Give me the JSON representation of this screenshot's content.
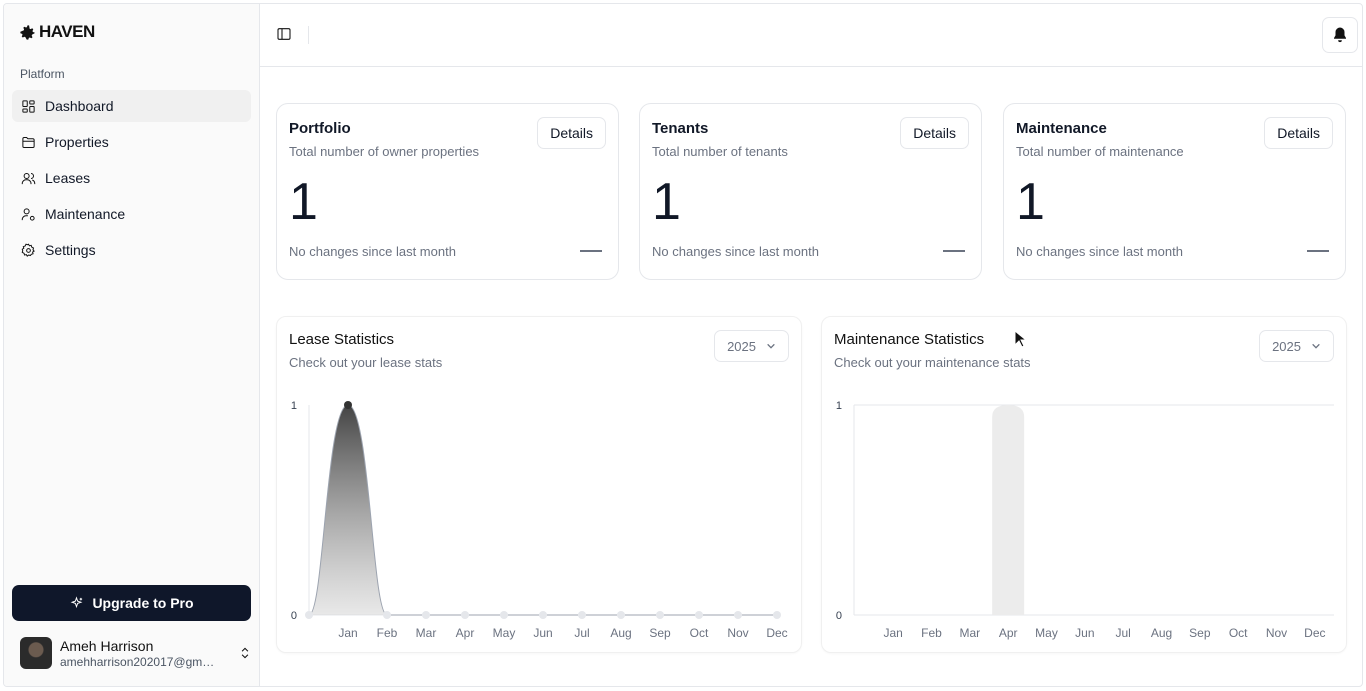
{
  "brand": {
    "name": "HAVEN"
  },
  "sidebar": {
    "section_label": "Platform",
    "items": [
      {
        "label": "Dashboard",
        "icon": "dashboard-icon",
        "active": true
      },
      {
        "label": "Properties",
        "icon": "folder-icon",
        "active": false
      },
      {
        "label": "Leases",
        "icon": "users-icon",
        "active": false
      },
      {
        "label": "Maintenance",
        "icon": "user-cog-icon",
        "active": false
      },
      {
        "label": "Settings",
        "icon": "gear-icon",
        "active": false
      }
    ],
    "upgrade_label": "Upgrade to Pro",
    "user": {
      "name": "Ameh Harrison",
      "email": "amehharrison202017@gmail.c..."
    }
  },
  "cards": [
    {
      "title": "Portfolio",
      "subtitle": "Total number of owner properties",
      "button": "Details",
      "value": "1",
      "footer": "No changes since last month"
    },
    {
      "title": "Tenants",
      "subtitle": "Total number of tenants",
      "button": "Details",
      "value": "1",
      "footer": "No changes since last month"
    },
    {
      "title": "Maintenance",
      "subtitle": "Total number of maintenance",
      "button": "Details",
      "value": "1",
      "footer": "No changes since last month"
    }
  ],
  "charts": {
    "lease": {
      "title": "Lease Statistics",
      "subtitle": "Check out your lease stats",
      "year": "2025"
    },
    "maintenance": {
      "title": "Maintenance Statistics",
      "subtitle": "Check out your maintenance stats",
      "year": "2025"
    }
  },
  "chart_data": [
    {
      "type": "area",
      "title": "Lease Statistics",
      "categories": [
        "Jan",
        "Feb",
        "Mar",
        "Apr",
        "May",
        "Jun",
        "Jul",
        "Aug",
        "Sep",
        "Oct",
        "Nov",
        "Dec"
      ],
      "values": [
        1,
        0,
        0,
        0,
        0,
        0,
        0,
        0,
        0,
        0,
        0,
        0
      ],
      "yticks": [
        "0",
        "1"
      ],
      "ylim": [
        0,
        1
      ],
      "grid": false
    },
    {
      "type": "bar",
      "title": "Maintenance Statistics",
      "categories": [
        "Jan",
        "Feb",
        "Mar",
        "Apr",
        "May",
        "Jun",
        "Jul",
        "Aug",
        "Sep",
        "Oct",
        "Nov",
        "Dec"
      ],
      "values": [
        0,
        0,
        0,
        1,
        0,
        0,
        0,
        0,
        0,
        0,
        0,
        0
      ],
      "yticks": [
        "0",
        "1"
      ],
      "ylim": [
        0,
        1
      ],
      "grid": true
    }
  ]
}
